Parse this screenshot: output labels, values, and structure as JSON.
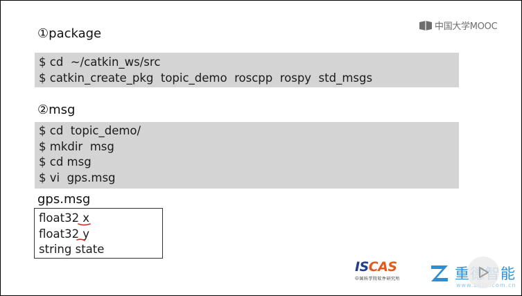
{
  "brand": {
    "mooc": "中国大学MOOC",
    "iscas": {
      "word_a": "IS",
      "word_b": "CAS",
      "subtitle": "中国科学院软件研究所"
    },
    "zhongruan": {
      "text": "重德智能",
      "url": "www.zdzn.com.cn"
    }
  },
  "sections": {
    "package": {
      "heading": "①package",
      "lines": [
        "$ cd  ~/catkin_ws/src",
        "$ catkin_create_pkg  topic_demo  roscpp  rospy  std_msgs"
      ]
    },
    "msg": {
      "heading": "②msg",
      "lines": [
        "$ cd  topic_demo/",
        "$ mkdir  msg",
        "$ cd msg",
        "$ vi  gps.msg"
      ]
    },
    "gps": {
      "heading": "gps.msg",
      "lines": [
        "float32 x",
        "float32 y",
        "string state"
      ]
    }
  },
  "colors": {
    "code_bg": "#d4d4d4",
    "annotation_red": "#e02020",
    "mooc_gray": "#6d6d6d",
    "iscas_blue": "#1f3d8a",
    "iscas_orange": "#e25a1c",
    "zhongruan_blue": "#2a8fd6"
  }
}
